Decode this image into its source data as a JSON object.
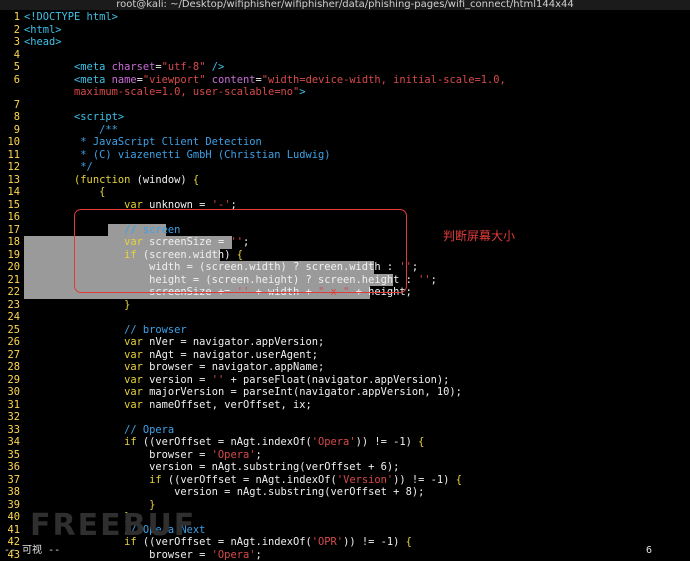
{
  "window": {
    "title": "root@kali: ~/Desktop/wifiphisher/wifiphisher/data/phishing-pages/wifi_connect/html144x44"
  },
  "colors": {
    "tag": "#3ec1e6",
    "attr": "#c86dd7",
    "string": "#d74a4a",
    "keyword": "#e6d33d",
    "comment": "#3ea1e6",
    "plain": "#f0f0f0",
    "line_number": "#ffd84d",
    "selection": "#9a9a9a",
    "annotation": "#e23a3a"
  },
  "code_lines": [
    {
      "n": "1",
      "segs": [
        [
          "tag",
          "<!DOCTYPE html>"
        ]
      ]
    },
    {
      "n": "2",
      "segs": [
        [
          "tag",
          "<html>"
        ]
      ]
    },
    {
      "n": "3",
      "segs": [
        [
          "tag",
          "<head>"
        ]
      ]
    },
    {
      "n": "4",
      "segs": []
    },
    {
      "n": "5",
      "segs": [
        [
          "pl",
          "        "
        ],
        [
          "tag",
          "<meta "
        ],
        [
          "attr",
          "charset"
        ],
        [
          "pl",
          "="
        ],
        [
          "str",
          "\"utf-8\""
        ],
        [
          "tag",
          " />"
        ]
      ]
    },
    {
      "n": "6",
      "segs": [
        [
          "pl",
          "        "
        ],
        [
          "tag",
          "<meta "
        ],
        [
          "attr",
          "name"
        ],
        [
          "pl",
          "="
        ],
        [
          "str",
          "\"viewport\""
        ],
        [
          "tag",
          " "
        ],
        [
          "attr",
          "content"
        ],
        [
          "pl",
          "="
        ],
        [
          "str",
          "\"width=device-width, initial-scale=1.0,"
        ]
      ]
    },
    {
      "n": "",
      "segs": [
        [
          "str",
          "        maximum-scale=1.0, user-scalable=no\""
        ],
        [
          "tag",
          ">"
        ]
      ]
    },
    {
      "n": "7",
      "segs": []
    },
    {
      "n": "8",
      "segs": [
        [
          "pl",
          "        "
        ],
        [
          "tag",
          "<script>"
        ]
      ]
    },
    {
      "n": "9",
      "segs": [
        [
          "cm",
          "            /**"
        ]
      ]
    },
    {
      "n": "10",
      "segs": [
        [
          "cm",
          "         * JavaScript Client Detection"
        ]
      ]
    },
    {
      "n": "11",
      "segs": [
        [
          "cm",
          "         * (C) viazenetti GmbH (Christian Ludwig)"
        ]
      ]
    },
    {
      "n": "12",
      "segs": [
        [
          "cm",
          "         */"
        ]
      ]
    },
    {
      "n": "13",
      "segs": [
        [
          "pl",
          "        "
        ],
        [
          "kw",
          "(function"
        ],
        [
          "pl",
          " (window) "
        ],
        [
          "kw",
          "{"
        ]
      ]
    },
    {
      "n": "14",
      "segs": [
        [
          "kw",
          "            {"
        ]
      ]
    },
    {
      "n": "15",
      "segs": [
        [
          "pl",
          "                "
        ],
        [
          "kw",
          "var"
        ],
        [
          "pl",
          " unknown = "
        ],
        [
          "str",
          "'-'"
        ],
        [
          "pl",
          ";"
        ]
      ]
    },
    {
      "n": "16",
      "segs": []
    },
    {
      "n": "17",
      "hl": [
        108,
        166
      ],
      "segs": [
        [
          "cm",
          "                // screen"
        ]
      ]
    },
    {
      "n": "18",
      "hl": [
        24,
        232
      ],
      "segs": [
        [
          "pl",
          "                "
        ],
        [
          "kw",
          "var"
        ],
        [
          "pl",
          " screenSize = "
        ],
        [
          "str",
          "''"
        ],
        [
          "pl",
          ";"
        ]
      ]
    },
    {
      "n": "19",
      "hl": [
        24,
        220
      ],
      "segs": [
        [
          "pl",
          "                "
        ],
        [
          "kw",
          "if"
        ],
        [
          "pl",
          " (screen.width) "
        ],
        [
          "kw",
          "{"
        ]
      ]
    },
    {
      "n": "20",
      "hl": [
        24,
        374
      ],
      "segs": [
        [
          "pl",
          "                    width = (screen.width) ? screen.width : "
        ],
        [
          "str",
          "''"
        ],
        [
          "pl",
          ";"
        ]
      ]
    },
    {
      "n": "21",
      "hl": [
        24,
        393
      ],
      "segs": [
        [
          "pl",
          "                    height = (screen.height) ? screen.height : "
        ],
        [
          "str",
          "''"
        ],
        [
          "pl",
          ";"
        ]
      ]
    },
    {
      "n": "22",
      "hl": [
        24,
        370
      ],
      "segs": [
        [
          "pl",
          "                    screenSize += "
        ],
        [
          "str",
          "''"
        ],
        [
          "pl",
          " + width + "
        ],
        [
          "str",
          "\" x \""
        ],
        [
          "pl",
          " + height;"
        ]
      ]
    },
    {
      "n": "23",
      "segs": [
        [
          "kw",
          "                }"
        ]
      ]
    },
    {
      "n": "24",
      "segs": []
    },
    {
      "n": "25",
      "segs": [
        [
          "cm",
          "                // browser"
        ]
      ]
    },
    {
      "n": "26",
      "segs": [
        [
          "pl",
          "                "
        ],
        [
          "kw",
          "var"
        ],
        [
          "pl",
          " nVer = navigator.appVersion;"
        ]
      ]
    },
    {
      "n": "27",
      "segs": [
        [
          "pl",
          "                "
        ],
        [
          "kw",
          "var"
        ],
        [
          "pl",
          " nAgt = navigator.userAgent;"
        ]
      ]
    },
    {
      "n": "28",
      "segs": [
        [
          "pl",
          "                "
        ],
        [
          "kw",
          "var"
        ],
        [
          "pl",
          " browser = navigator.appName;"
        ]
      ]
    },
    {
      "n": "29",
      "segs": [
        [
          "pl",
          "                "
        ],
        [
          "kw",
          "var"
        ],
        [
          "pl",
          " version = "
        ],
        [
          "str",
          "''"
        ],
        [
          "pl",
          " + parseFloat(navigator.appVersion);"
        ]
      ]
    },
    {
      "n": "30",
      "segs": [
        [
          "pl",
          "                "
        ],
        [
          "kw",
          "var"
        ],
        [
          "pl",
          " majorVersion = parseInt(navigator.appVersion, 10);"
        ]
      ]
    },
    {
      "n": "31",
      "segs": [
        [
          "pl",
          "                "
        ],
        [
          "kw",
          "var"
        ],
        [
          "pl",
          " nameOffset, verOffset, ix;"
        ]
      ]
    },
    {
      "n": "32",
      "segs": []
    },
    {
      "n": "33",
      "segs": [
        [
          "cm",
          "                // Opera"
        ]
      ]
    },
    {
      "n": "34",
      "segs": [
        [
          "pl",
          "                "
        ],
        [
          "kw",
          "if"
        ],
        [
          "pl",
          " ((verOffset = nAgt.indexOf("
        ],
        [
          "str",
          "'Opera'"
        ],
        [
          "pl",
          ")) != -1) "
        ],
        [
          "kw",
          "{"
        ]
      ]
    },
    {
      "n": "35",
      "segs": [
        [
          "pl",
          "                    browser = "
        ],
        [
          "str",
          "'Opera'"
        ],
        [
          "pl",
          ";"
        ]
      ]
    },
    {
      "n": "36",
      "segs": [
        [
          "pl",
          "                    version = nAgt.substring(verOffset + 6);"
        ]
      ]
    },
    {
      "n": "37",
      "segs": [
        [
          "pl",
          "                    "
        ],
        [
          "kw",
          "if"
        ],
        [
          "pl",
          " ((verOffset = nAgt.indexOf("
        ],
        [
          "str",
          "'Version'"
        ],
        [
          "pl",
          ")) != -1) "
        ],
        [
          "kw",
          "{"
        ]
      ]
    },
    {
      "n": "38",
      "segs": [
        [
          "pl",
          "                        version = nAgt.substring(verOffset + 8);"
        ]
      ]
    },
    {
      "n": "39",
      "segs": [
        [
          "kw",
          "                    }"
        ]
      ]
    },
    {
      "n": "40",
      "segs": [
        [
          "kw",
          "                }"
        ]
      ]
    },
    {
      "n": "41",
      "segs": [
        [
          "cm",
          "                // Opera Next"
        ]
      ]
    },
    {
      "n": "42",
      "segs": [
        [
          "pl",
          "                "
        ],
        [
          "kw",
          "if"
        ],
        [
          "pl",
          " ((verOffset = nAgt.indexOf("
        ],
        [
          "str",
          "'OPR'"
        ],
        [
          "pl",
          ")) != -1) "
        ],
        [
          "kw",
          "{"
        ]
      ]
    },
    {
      "n": "43",
      "segs": [
        [
          "pl",
          "                    browser = "
        ],
        [
          "str",
          "'Opera'"
        ],
        [
          "pl",
          ";"
        ]
      ]
    }
  ],
  "status": {
    "mode": "-- 可视 --",
    "count": "6"
  },
  "annotation": {
    "text": "判断屏幕大小"
  },
  "watermark": {
    "text": "FREEBUF"
  }
}
